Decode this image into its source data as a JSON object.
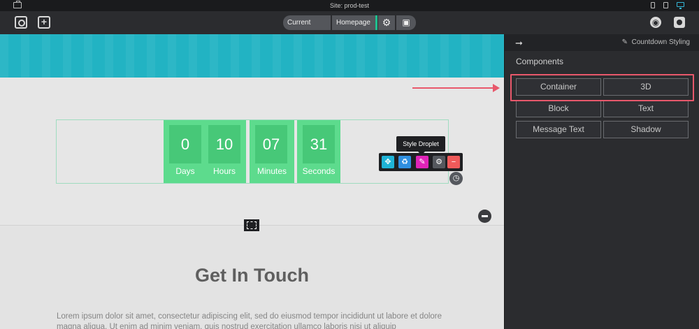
{
  "os_bar": {
    "site_title": "Site: prod-test"
  },
  "toolbar": {
    "current_page_label": "Current Page",
    "homepage_label": "Homepage",
    "settings_icon": "gear-icon",
    "save_icon": "save-icon",
    "globe_icon": "globe-icon",
    "preview_icon": "eye-icon"
  },
  "countdown": {
    "cells": [
      {
        "value": "0",
        "label": "Days"
      },
      {
        "value": "10",
        "label": "Hours"
      },
      {
        "value": "07",
        "label": "Minutes"
      },
      {
        "value": "31",
        "label": "Seconds"
      }
    ],
    "accent_color": "#5ddb8d"
  },
  "droplet": {
    "tooltip": "Style Droplet",
    "buttons": [
      "move-icon",
      "recycle-icon",
      "brush-icon",
      "gear-icon",
      "minus-icon"
    ]
  },
  "content": {
    "heading": "Get In Touch",
    "paragraph": "Lorem ipsum dolor sit amet, consectetur adipiscing elit, sed do eiusmod tempor incididunt ut labore et dolore magna aliqua. Ut enim ad minim veniam, quis nostrud exercitation ullamco laboris nisi ut aliquip"
  },
  "panel": {
    "header_label": "Countdown Styling",
    "components_title": "Components",
    "components": [
      "Container",
      "3D",
      "Block",
      "Text",
      "Message Text",
      "Shadow"
    ],
    "highlight_color": "#e8586b"
  }
}
